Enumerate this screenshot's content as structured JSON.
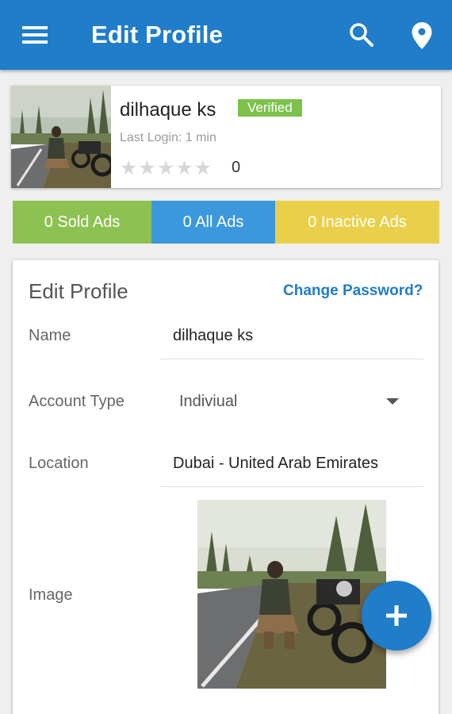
{
  "appbar": {
    "title": "Edit Profile",
    "icons": [
      "menu-icon",
      "search-icon",
      "location-pin-icon"
    ],
    "color": "#1f7dc9"
  },
  "profile": {
    "name": "dilhaque ks",
    "badge": "Verified",
    "last_login": "Last Login: 1 min",
    "stars_display": "★★★★★",
    "star_rating": 0,
    "rating_count": "0"
  },
  "stats": {
    "sold": "0 Sold Ads",
    "all": "0 All Ads",
    "inactive": "0 Inactive Ads",
    "colors": {
      "sold": "#8dc252",
      "all": "#3b98dd",
      "inactive": "#ead04a"
    }
  },
  "form": {
    "title": "Edit Profile",
    "change_password": "Change Password?",
    "name_label": "Name",
    "name_value": "dilhaque ks",
    "account_type_label": "Account Type",
    "account_type_value": "Indiviual",
    "location_label": "Location",
    "location_value": "Dubai - United Arab Emirates",
    "image_label": "Image"
  },
  "fab": {
    "icon": "plus-icon"
  }
}
